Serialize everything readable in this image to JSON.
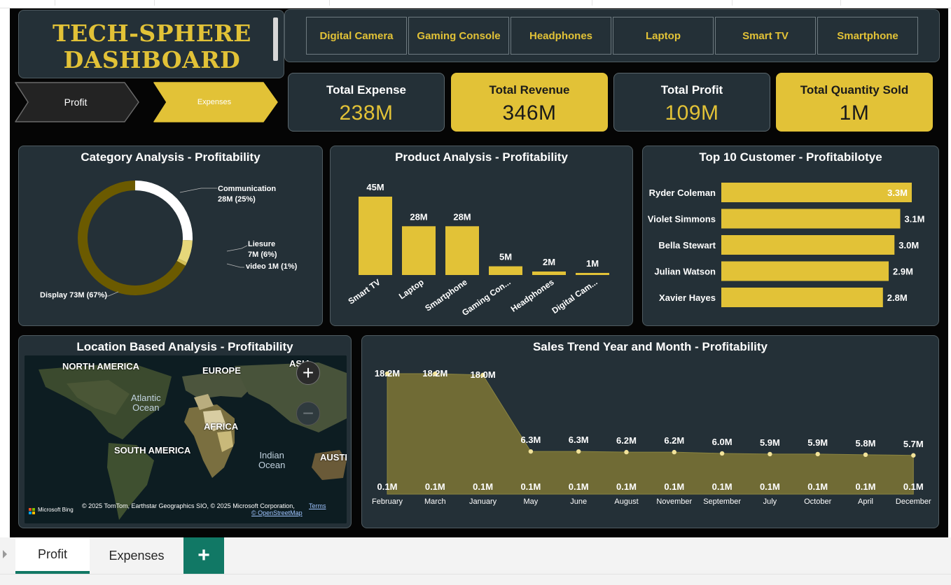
{
  "title": {
    "line1": "TECH-SPHERE",
    "line2": "DASHBOARD"
  },
  "slicers": [
    "Digital Camera",
    "Gaming Console",
    "Headphones",
    "Laptop",
    "Smart TV",
    "Smartphone"
  ],
  "page_buttons": {
    "profit": "Profit",
    "expenses": "Expenses"
  },
  "kpis": [
    {
      "label": "Total Expense",
      "value": "238M",
      "style": "dark"
    },
    {
      "label": "Total Revenue",
      "value": "346M",
      "style": "gold"
    },
    {
      "label": "Total Profit",
      "value": "109M",
      "style": "dark"
    },
    {
      "label": "Total Quantity Sold",
      "value": "1M",
      "style": "gold"
    }
  ],
  "colors": {
    "gold": "#e2c237",
    "panel": "#243037",
    "olive": "#6b5a00",
    "area": "#706b35",
    "teal": "#117865"
  },
  "panels": {
    "category": "Category Analysis - Profitability",
    "product": "Product Analysis - Profitability",
    "customers": "Top 10 Customer - Profitabilotye",
    "location": "Location Based Analysis - Profitability",
    "trend": "Sales Trend Year and Month - Profitability"
  },
  "map": {
    "labels": [
      "NORTH AMERICA",
      "EUROPE",
      "ASIA",
      "AFRICA",
      "SOUTH AMERICA",
      "AUSTR"
    ],
    "oceans": {
      "atlantic_1": "Atlantic",
      "atlantic_2": "Ocean",
      "indian_1": "Indian",
      "indian_2": "Ocean"
    },
    "attribution": "© 2025 TomTom, Earthstar Geographics SIO, © 2025 Microsoft Corporation,",
    "terms": "Terms",
    "osm": "© OpenStreetMap",
    "brand": "Microsoft Bing",
    "zoom_in": "+",
    "zoom_out": "−"
  },
  "tabs": {
    "profit": "Profit",
    "expenses": "Expenses",
    "add": "+"
  },
  "chart_data": [
    {
      "type": "pie",
      "title": "Category Analysis - Profitability",
      "donut": true,
      "slices": [
        {
          "name": "Communication",
          "value": 28,
          "pct": 25,
          "label1": "Communication",
          "label2": "28M (25%)",
          "color": "#ffffff"
        },
        {
          "name": "Liesure",
          "value": 7,
          "pct": 6,
          "label1": "Liesure",
          "label2": "7M (6%)",
          "color": "#e6d77a"
        },
        {
          "name": "video",
          "value": 1,
          "pct": 1,
          "label1": "video 1M (1%)",
          "label2": "",
          "color": "#d4c058"
        },
        {
          "name": "Display",
          "value": 73,
          "pct": 67,
          "label1": "Display 73M (67%)",
          "label2": "",
          "color": "#6b5a00"
        }
      ]
    },
    {
      "type": "bar",
      "title": "Product Analysis - Profitability",
      "categories": [
        "Smart TV",
        "Laptop",
        "Smartphone",
        "Gaming Con...",
        "Headphones",
        "Digital Cam..."
      ],
      "values": [
        45,
        28,
        28,
        5,
        2,
        1
      ],
      "labels": [
        "45M",
        "28M",
        "28M",
        "5M",
        "2M",
        "1M"
      ],
      "ylim": [
        0,
        45
      ]
    },
    {
      "type": "bar",
      "orientation": "horizontal",
      "title": "Top 10 Customer - Profitabilotye",
      "categories": [
        "Ryder Coleman",
        "Violet Simmons",
        "Bella Stewart",
        "Julian Watson",
        "Xavier Hayes"
      ],
      "values": [
        3.3,
        3.1,
        3.0,
        2.9,
        2.8
      ],
      "labels": [
        "3.3M",
        "3.1M",
        "3.0M",
        "2.9M",
        "2.8M"
      ],
      "xlim": [
        0,
        3.3
      ]
    },
    {
      "type": "area",
      "title": "Sales Trend Year and Month - Profitability",
      "categories": [
        "February",
        "March",
        "January",
        "May",
        "June",
        "August",
        "November",
        "September",
        "July",
        "October",
        "April",
        "December"
      ],
      "series": [
        {
          "values": [
            18.2,
            18.2,
            18.0,
            6.3,
            6.3,
            6.2,
            6.2,
            6.0,
            5.9,
            5.9,
            5.8,
            5.7
          ],
          "labels": [
            "18.2M",
            "18.2M",
            "18.0M",
            "6.3M",
            "6.3M",
            "6.2M",
            "6.2M",
            "6.0M",
            "5.9M",
            "5.9M",
            "5.8M",
            "5.7M"
          ]
        },
        {
          "values": [
            0.1,
            0.1,
            0.1,
            0.1,
            0.1,
            0.1,
            0.1,
            0.1,
            0.1,
            0.1,
            0.1,
            0.1
          ],
          "labels": [
            "0.1M",
            "0.1M",
            "0.1M",
            "0.1M",
            "0.1M",
            "0.1M",
            "0.1M",
            "0.1M",
            "0.1M",
            "0.1M",
            "0.1M",
            "0.1M"
          ]
        }
      ],
      "ylim": [
        0,
        18.2
      ]
    }
  ]
}
